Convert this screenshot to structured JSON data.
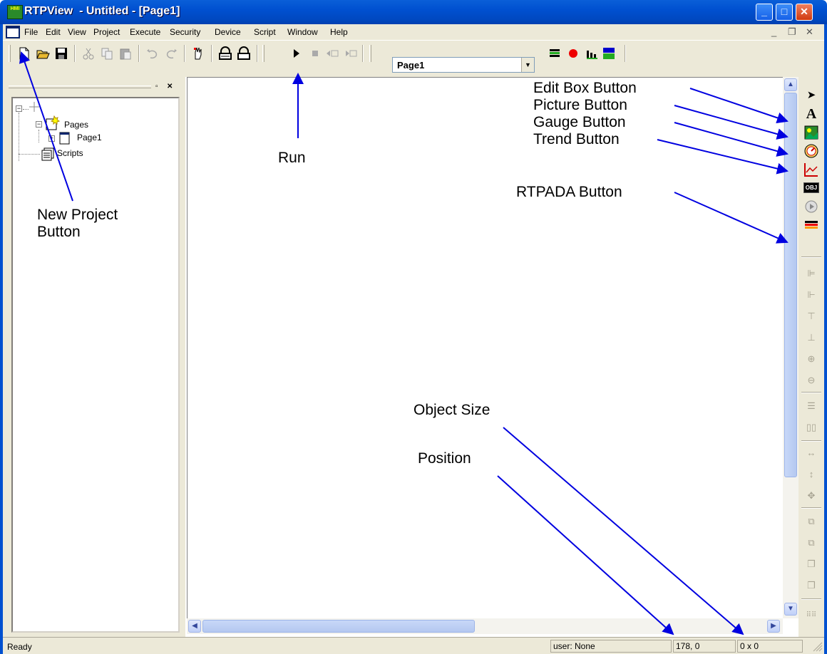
{
  "window": {
    "app_icon_text": "HMI",
    "title": "RTPView  - Untitled - [Page1]",
    "minimize": "_",
    "maximize": "□",
    "close": "✕"
  },
  "menu": {
    "items": [
      "File",
      "Edit",
      "View",
      "Project",
      "Execute",
      "Security",
      "Device",
      "Script",
      "Window",
      "Help"
    ],
    "mdi_minimize": "_",
    "mdi_restore": "❐",
    "mdi_close": "✕"
  },
  "toolbar": {
    "page_combo_value": "Page1",
    "icons": [
      "new-icon",
      "open-icon",
      "save-icon",
      "cut-icon",
      "copy-icon",
      "paste-icon",
      "undo-icon",
      "redo-icon",
      "hand-icon",
      "lock-icon",
      "unlock-icon",
      "run-icon",
      "stop-icon",
      "step-back-icon",
      "step-forward-icon",
      "rtpada-icon",
      "record-icon",
      "chart-icon",
      "rtp-fifo-icon"
    ]
  },
  "tree": {
    "root_expander": "−",
    "pages_expander": "−",
    "page1_expander": "+",
    "pages_label": "Pages",
    "page1_label": "Page1",
    "scripts_label": "Scripts"
  },
  "right_toolbar": {
    "tools": [
      "pointer-icon",
      "text-icon",
      "picture-icon",
      "gauge-icon",
      "trend-icon",
      "obj-icon",
      "play-icon",
      "rtpada-icon"
    ],
    "obj_label": "OBJ",
    "text_label": "A",
    "pointer_label": "➤",
    "align_tools": [
      "align-left-icon",
      "align-right-icon",
      "align-top-icon",
      "align-bottom-icon",
      "center-h-icon",
      "center-v-icon",
      "space-v-icon",
      "space-h-icon",
      "same-width-icon",
      "same-height-icon",
      "same-size-icon",
      "bring-front-icon",
      "send-back-icon",
      "forward-icon",
      "backward-icon",
      "grid-icon"
    ]
  },
  "status": {
    "ready": "Ready",
    "user": "user: None",
    "position": "178, 0",
    "size": "0 x 0"
  },
  "annotations": {
    "new_project": "New Project\nButton",
    "run": "Run",
    "edit_box": "Edit Box Button",
    "picture": "Picture Button",
    "gauge": "Gauge Button",
    "trend": "Trend Button",
    "rtpada": "RTPADA Button",
    "object_size": "Object Size",
    "position": "Position"
  },
  "colors": {
    "annotation_arrow": "#0000e0",
    "title_bar": "#0050d0",
    "chrome": "#ece9d8"
  }
}
